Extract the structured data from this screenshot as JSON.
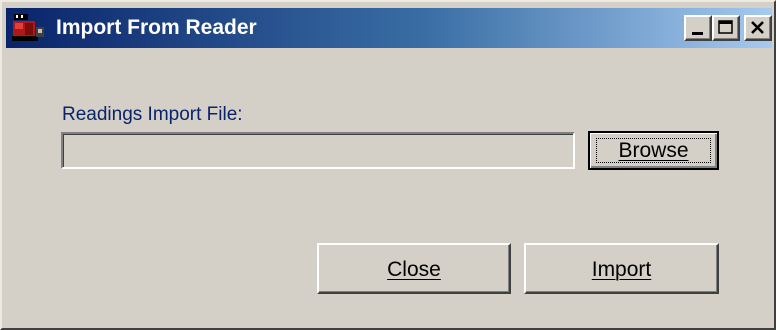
{
  "window": {
    "title": "Import From Reader",
    "icon": "reader-app-icon"
  },
  "title_controls": {
    "minimize": "minimize-icon",
    "maximize": "maximize-icon",
    "close": "close-icon"
  },
  "form": {
    "file_label": "Readings Import File:",
    "file_value": "",
    "browse_label": "Browse"
  },
  "actions": {
    "close_label": "Close",
    "import_label": "Import"
  },
  "colors": {
    "face": "#d4d0c8",
    "title_start": "#0a246a",
    "title_end": "#a6caf0",
    "label_text": "#0a246a"
  }
}
